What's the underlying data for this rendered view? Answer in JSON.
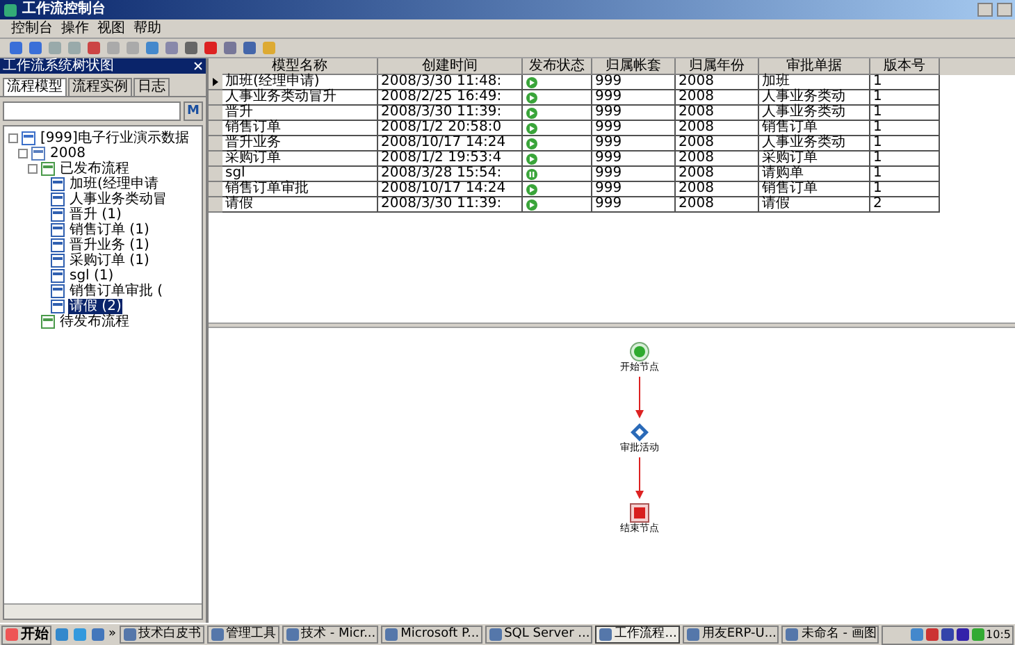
{
  "window": {
    "title": "工作流控制台"
  },
  "menu": [
    "控制台",
    "操作",
    "视图",
    "帮助"
  ],
  "panel": {
    "title": "工作流系统树状图",
    "tabs": [
      {
        "label": "流程模型",
        "selected": true
      },
      {
        "label": "流程实例",
        "selected": false
      },
      {
        "label": "日志",
        "selected": false
      }
    ],
    "search_button": "M"
  },
  "tree": [
    {
      "label": "[999]电子行业演示数据",
      "kind": "database",
      "selected": false,
      "children": [
        {
          "label": "2008",
          "kind": "year",
          "selected": false,
          "children": [
            {
              "label": "已发布流程",
              "kind": "folder",
              "selected": false,
              "children": [
                {
                  "label": "加班(经理申请",
                  "kind": "model",
                  "selected": false
                },
                {
                  "label": "人事业务类动冒",
                  "kind": "model",
                  "selected": false
                },
                {
                  "label": "晋升 (1)",
                  "kind": "model",
                  "selected": false
                },
                {
                  "label": "销售订单 (1)",
                  "kind": "model",
                  "selected": false
                },
                {
                  "label": "晋升业务 (1)",
                  "kind": "model",
                  "selected": false
                },
                {
                  "label": "采购订单 (1)",
                  "kind": "model",
                  "selected": false
                },
                {
                  "label": "sgl (1)",
                  "kind": "model",
                  "selected": false
                },
                {
                  "label": "销售订单审批 (",
                  "kind": "model",
                  "selected": false
                },
                {
                  "label": "请假 (2)",
                  "kind": "model",
                  "selected": true
                }
              ]
            },
            {
              "label": "待发布流程",
              "kind": "folder",
              "selected": false
            }
          ]
        }
      ]
    }
  ],
  "table": {
    "columns": [
      "模型名称",
      "创建时间",
      "发布状态",
      "归属帐套",
      "归属年份",
      "审批单据",
      "版本号"
    ],
    "rows": [
      {
        "current": true,
        "cells": [
          "加班(经理申请)",
          "2008/3/30 11:48:",
          {
            "kind": "published"
          },
          "999",
          "2008",
          "加班",
          "1"
        ]
      },
      {
        "current": false,
        "cells": [
          "人事业务类动冒升",
          "2008/2/25 16:49:",
          {
            "kind": "published"
          },
          "999",
          "2008",
          "人事业务类动",
          "1"
        ]
      },
      {
        "current": false,
        "cells": [
          "晋升",
          "2008/3/30 11:39:",
          {
            "kind": "published"
          },
          "999",
          "2008",
          "人事业务类动",
          "1"
        ]
      },
      {
        "current": false,
        "cells": [
          "销售订单",
          "2008/1/2 20:58:0",
          {
            "kind": "published"
          },
          "999",
          "2008",
          "销售订单",
          "1"
        ]
      },
      {
        "current": false,
        "cells": [
          "晋升业务",
          "2008/10/17 14:24",
          {
            "kind": "published"
          },
          "999",
          "2008",
          "人事业务类动",
          "1"
        ]
      },
      {
        "current": false,
        "cells": [
          "采购订单",
          "2008/1/2 19:53:4",
          {
            "kind": "published"
          },
          "999",
          "2008",
          "采购订单",
          "1"
        ]
      },
      {
        "current": false,
        "cells": [
          "sgl",
          "2008/3/28 15:54:",
          {
            "kind": "paused"
          },
          "999",
          "2008",
          "请购单",
          "1"
        ]
      },
      {
        "current": false,
        "cells": [
          "销售订单审批",
          "2008/10/17 14:24",
          {
            "kind": "published"
          },
          "999",
          "2008",
          "销售订单",
          "1"
        ]
      },
      {
        "current": false,
        "cells": [
          "请假",
          "2008/3/30 11:39:",
          {
            "kind": "published"
          },
          "999",
          "2008",
          "请假",
          "2"
        ]
      }
    ]
  },
  "flow": {
    "nodes": [
      {
        "kind": "start",
        "label": "开始节点"
      },
      {
        "kind": "activity",
        "label": "审批活动"
      },
      {
        "kind": "end",
        "label": "结束节点"
      }
    ]
  },
  "taskbar": {
    "start": "开始",
    "more": "»",
    "tasks": [
      {
        "label": "技术白皮书",
        "selected": false
      },
      {
        "label": "管理工具",
        "selected": false
      },
      {
        "label": "技术 - Micr...",
        "selected": false
      },
      {
        "label": "Microsoft P...",
        "selected": false
      },
      {
        "label": "SQL Server ...",
        "selected": false
      },
      {
        "label": "工作流程...",
        "selected": true
      },
      {
        "label": "用友ERP-U...",
        "selected": false
      },
      {
        "label": "未命名 - 画图",
        "selected": false
      }
    ],
    "clock": "10:5"
  }
}
